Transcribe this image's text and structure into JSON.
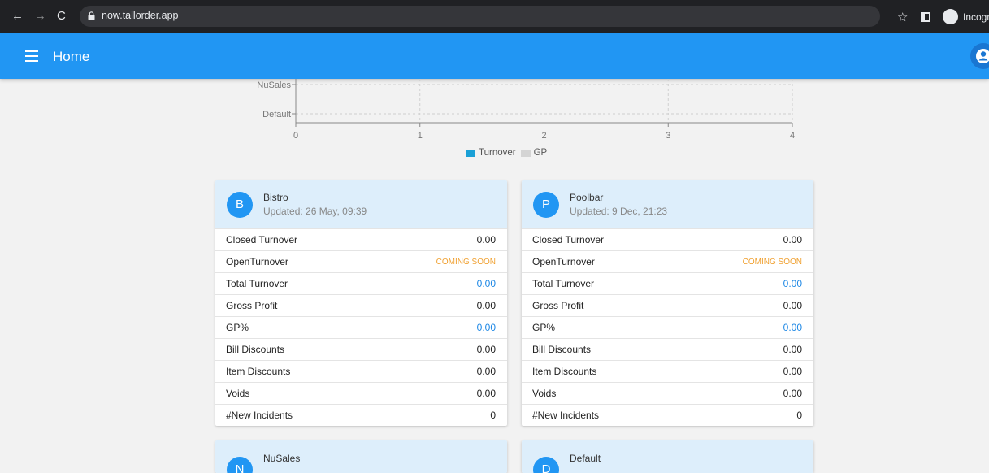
{
  "browser": {
    "url": "now.tallorder.app",
    "profile_label": "Incogn"
  },
  "app_bar": {
    "title": "Home"
  },
  "chart_data": {
    "type": "bar",
    "orientation": "horizontal",
    "categories": [
      "NuSales",
      "Default"
    ],
    "series": [
      {
        "name": "Turnover",
        "values": [
          0,
          0
        ],
        "color": "#1aa0d6"
      },
      {
        "name": "GP",
        "values": [
          0,
          0
        ],
        "color": "#d4d4d4"
      }
    ],
    "x_ticks": [
      "0",
      "1",
      "2",
      "3",
      "4"
    ],
    "xlim": [
      0,
      4
    ],
    "grid": true,
    "legend_position": "bottom-center"
  },
  "cards": [
    {
      "initial": "B",
      "name": "Bistro",
      "updated": "Updated: 26 May, 09:39",
      "rows": [
        {
          "label": "Closed Turnover",
          "value": "0.00",
          "style": "normal"
        },
        {
          "label": "OpenTurnover",
          "value": "COMING SOON",
          "style": "soon"
        },
        {
          "label": "Total Turnover",
          "value": "0.00",
          "style": "accent"
        },
        {
          "label": "Gross Profit",
          "value": "0.00",
          "style": "normal"
        },
        {
          "label": "GP%",
          "value": "0.00",
          "style": "accent"
        },
        {
          "label": "Bill Discounts",
          "value": "0.00",
          "style": "normal"
        },
        {
          "label": "Item Discounts",
          "value": "0.00",
          "style": "normal"
        },
        {
          "label": "Voids",
          "value": "0.00",
          "style": "normal"
        },
        {
          "label": "#New Incidents",
          "value": "0",
          "style": "normal"
        }
      ]
    },
    {
      "initial": "P",
      "name": "Poolbar",
      "updated": "Updated: 9 Dec, 21:23",
      "rows": [
        {
          "label": "Closed Turnover",
          "value": "0.00",
          "style": "normal"
        },
        {
          "label": "OpenTurnover",
          "value": "COMING SOON",
          "style": "soon"
        },
        {
          "label": "Total Turnover",
          "value": "0.00",
          "style": "accent"
        },
        {
          "label": "Gross Profit",
          "value": "0.00",
          "style": "normal"
        },
        {
          "label": "GP%",
          "value": "0.00",
          "style": "accent"
        },
        {
          "label": "Bill Discounts",
          "value": "0.00",
          "style": "normal"
        },
        {
          "label": "Item Discounts",
          "value": "0.00",
          "style": "normal"
        },
        {
          "label": "Voids",
          "value": "0.00",
          "style": "normal"
        },
        {
          "label": "#New Incidents",
          "value": "0",
          "style": "normal"
        }
      ]
    },
    {
      "initial": "N",
      "name": "NuSales",
      "updated": "",
      "rows": []
    },
    {
      "initial": "D",
      "name": "Default",
      "updated": "",
      "rows": []
    }
  ],
  "colors": {
    "app_bar": "#2196f3",
    "card_header": "#ddeefb",
    "accent_value": "#1e88e5",
    "coming_soon": "#f0a030"
  }
}
